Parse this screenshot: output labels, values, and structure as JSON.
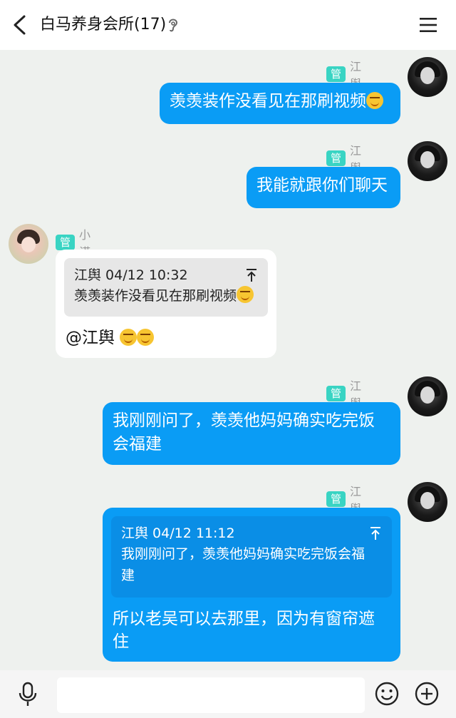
{
  "header": {
    "title": "白马养身会所(17)",
    "icons": [
      "back-icon",
      "ear-icon",
      "menu-icon"
    ]
  },
  "messages": [
    {
      "role": "管理员",
      "name": "江舆",
      "text": "羡羡装作没看见在那刷视频"
    },
    {
      "role": "管理员",
      "name": "江舆",
      "text": "我能就跟你们聊天"
    },
    {
      "role": "管理员",
      "name": "小诺",
      "quote": {
        "header": "江舆 04/12 10:32",
        "text": "羡羡装作没看见在那刷视频"
      },
      "text": "@江舆 "
    },
    {
      "role": "管理员",
      "name": "江舆",
      "text_line1": "我刚刚问了，羡羡他妈妈确实吃完饭",
      "text_line2": "会福建"
    },
    {
      "role": "管理员",
      "name": "江舆",
      "quote": {
        "header": "江舆 04/12 11:12",
        "text_line1": "我刚刚问了，羡羡他妈妈确实吃完饭会福",
        "text_line2": "建"
      },
      "text_line1": "所以老吴可以去那里，因为有窗帘遮",
      "text_line2": "住"
    }
  ],
  "input_bar": {
    "placeholder": "",
    "icons": [
      "microphone-icon",
      "emoji-icon",
      "add-icon"
    ]
  },
  "colors": {
    "bubble_me": "#0a9cf5",
    "badge": "#39d4c3",
    "background": "#eef1ee"
  }
}
